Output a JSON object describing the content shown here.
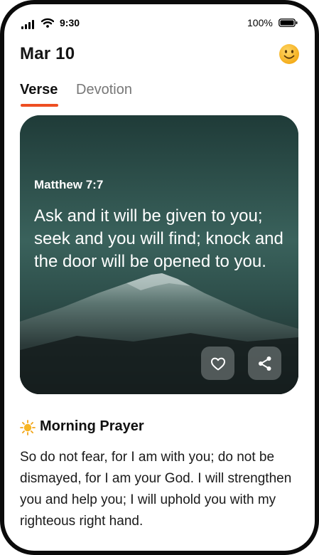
{
  "status_bar": {
    "time": "9:30",
    "battery_percent": "100%",
    "icons": [
      "cellular-signal-icon",
      "wifi-icon",
      "battery-icon"
    ]
  },
  "header": {
    "date": "Mar 10",
    "profile_icon": "smiley-face-icon"
  },
  "tabs": [
    {
      "label": "Verse",
      "active": true
    },
    {
      "label": "Devotion",
      "active": false
    }
  ],
  "verse_card": {
    "reference": "Matthew 7:7",
    "text": "Ask and it will be given to you; seek and you will find; knock and the door will be opened to you.",
    "actions": [
      {
        "icon": "heart-icon"
      },
      {
        "icon": "share-icon"
      }
    ]
  },
  "prayer": {
    "icon": "sun-icon",
    "title": "Morning Prayer",
    "text": "So do not fear, for I am with you; do not be dismayed, for I am your God. I will strengthen you and help you; I will uphold you with my righteous right hand."
  },
  "colors": {
    "accent": "#ee4e22",
    "tab_inactive": "#777777",
    "card_button": "#5c6464"
  }
}
